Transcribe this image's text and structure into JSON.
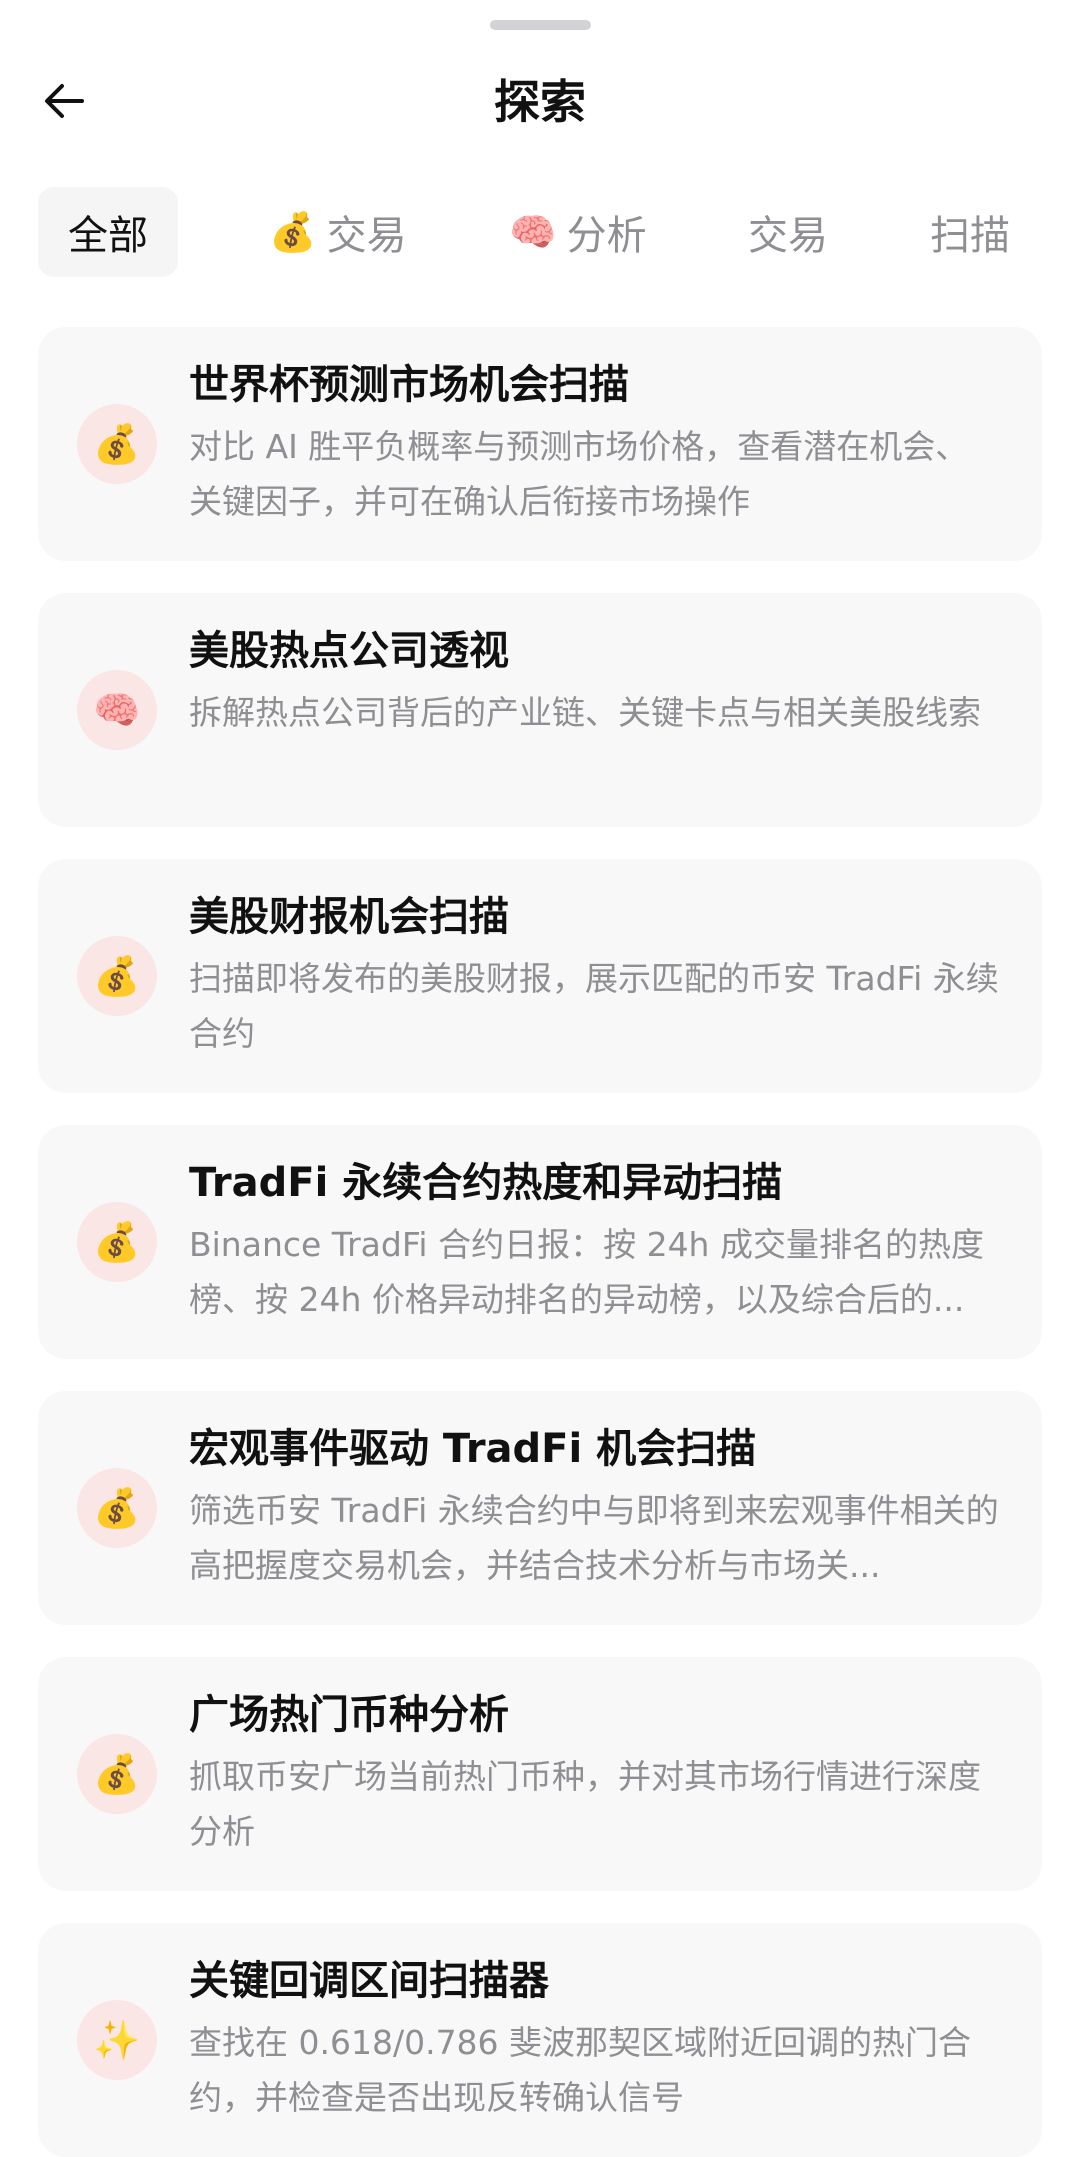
{
  "header": {
    "title": "探索"
  },
  "tabs": [
    {
      "label": "全部",
      "emoji": "",
      "active": true
    },
    {
      "label": "交易",
      "emoji": "💰",
      "active": false
    },
    {
      "label": "分析",
      "emoji": "🧠",
      "active": false
    },
    {
      "label": "交易",
      "emoji": "",
      "active": false
    },
    {
      "label": "扫描",
      "emoji": "",
      "active": false
    }
  ],
  "cards": [
    {
      "icon": "💰",
      "icon_name": "money-bag-icon",
      "title": "世界杯预测市场机会扫描",
      "desc": "对比 AI 胜平负概率与预测市场价格，查看潜在机会、关键因子，并可在确认后衔接市场操作"
    },
    {
      "icon": "🧠",
      "icon_name": "brain-icon",
      "title": "美股热点公司透视",
      "desc": "拆解热点公司背后的产业链、关键卡点与相关美股线索"
    },
    {
      "icon": "💰",
      "icon_name": "money-bag-icon",
      "title": "美股财报机会扫描",
      "desc": "扫描即将发布的美股财报，展示匹配的币安 TradFi 永续合约"
    },
    {
      "icon": "💰",
      "icon_name": "money-bag-icon",
      "title": "TradFi 永续合约热度和异动扫描",
      "desc": "Binance TradFi 合约日报：按 24h 成交量排名的热度榜、按 24h 价格异动排名的异动榜，以及综合后的..."
    },
    {
      "icon": "💰",
      "icon_name": "money-bag-icon",
      "title": "宏观事件驱动 TradFi 机会扫描",
      "desc": "筛选币安 TradFi 永续合约中与即将到来宏观事件相关的高把握度交易机会，并结合技术分析与市场关..."
    },
    {
      "icon": "💰",
      "icon_name": "money-bag-icon",
      "title": "广场热门币种分析",
      "desc": "抓取币安广场当前热门币种，并对其市场行情进行深度分析"
    },
    {
      "icon": "✨",
      "icon_name": "sparkles-icon",
      "title": "关键回调区间扫描器",
      "desc": "查找在 0.618/0.786 斐波那契区域附近回调的热门合约，并检查是否出现反转确认信号"
    }
  ]
}
